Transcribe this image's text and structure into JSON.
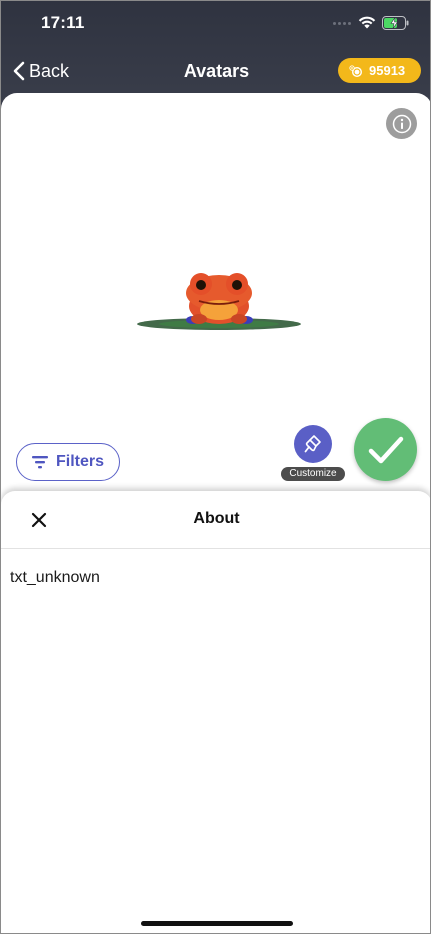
{
  "status_bar": {
    "time": "17:11",
    "icons": [
      "signal-dots-icon",
      "wifi-icon",
      "battery-charging-icon"
    ]
  },
  "nav": {
    "back_label": "Back",
    "title": "Avatars",
    "coins": "95913"
  },
  "preview": {
    "icons": [
      "info-icon",
      "frog-avatar"
    ]
  },
  "actions": {
    "filters_label": "Filters",
    "customize_label": "Customize",
    "confirm_icon": "checkmark-icon"
  },
  "about_sheet": {
    "title": "About",
    "body": "txt_unknown"
  },
  "colors": {
    "header_bg": "#2f3340",
    "coin_badge": "#f3b81a",
    "accent": "#5a5fc6",
    "confirm": "#62bd76"
  }
}
